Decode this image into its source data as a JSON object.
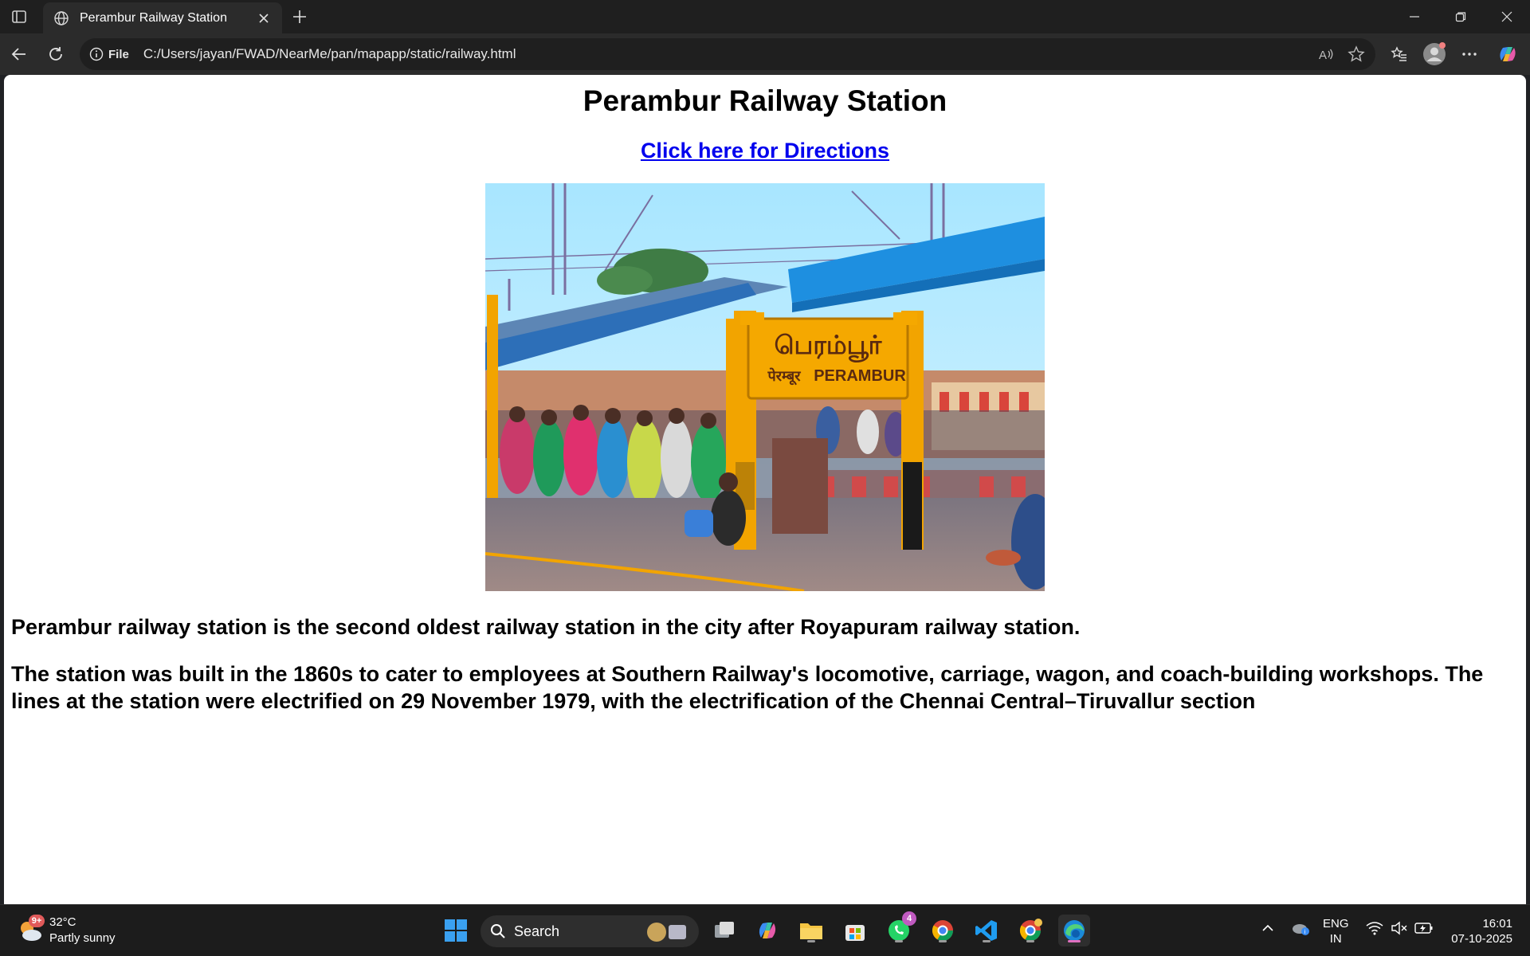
{
  "browser": {
    "tab_title": "Perambur Railway Station",
    "address_prefix": "File",
    "url": "C:/Users/jayan/FWAD/NearMe/pan/mapapp/static/railway.html"
  },
  "page": {
    "heading": "Perambur Railway Station",
    "directions_link": "Click here for Directions",
    "photo_sign_tamil": "பெரம்பூர்",
    "photo_sign_hindi": "पेरम्बूर",
    "photo_sign_english": "PERAMBUR",
    "paragraph1": "Perambur railway station is the second oldest railway station in the city after Royapuram railway station.",
    "paragraph2": "The station was built in the 1860s to cater to employees at Southern Railway's locomotive, carriage, wagon, and coach-building workshops. The lines at the station were electrified on 29 November 1979, with the electrification of the Chennai Central–Tiruvallur section"
  },
  "taskbar": {
    "weather_temp": "32°C",
    "weather_desc": "Partly sunny",
    "weather_badge": "9+",
    "search_label": "Search",
    "whatsapp_badge": "4",
    "lang_line1": "ENG",
    "lang_line2": "IN",
    "time": "16:01",
    "date": "07-10-2025"
  },
  "colors": {
    "link": "#0000ee",
    "sign_yellow": "#f2a400",
    "roof_blue": "#1e8fe0"
  }
}
